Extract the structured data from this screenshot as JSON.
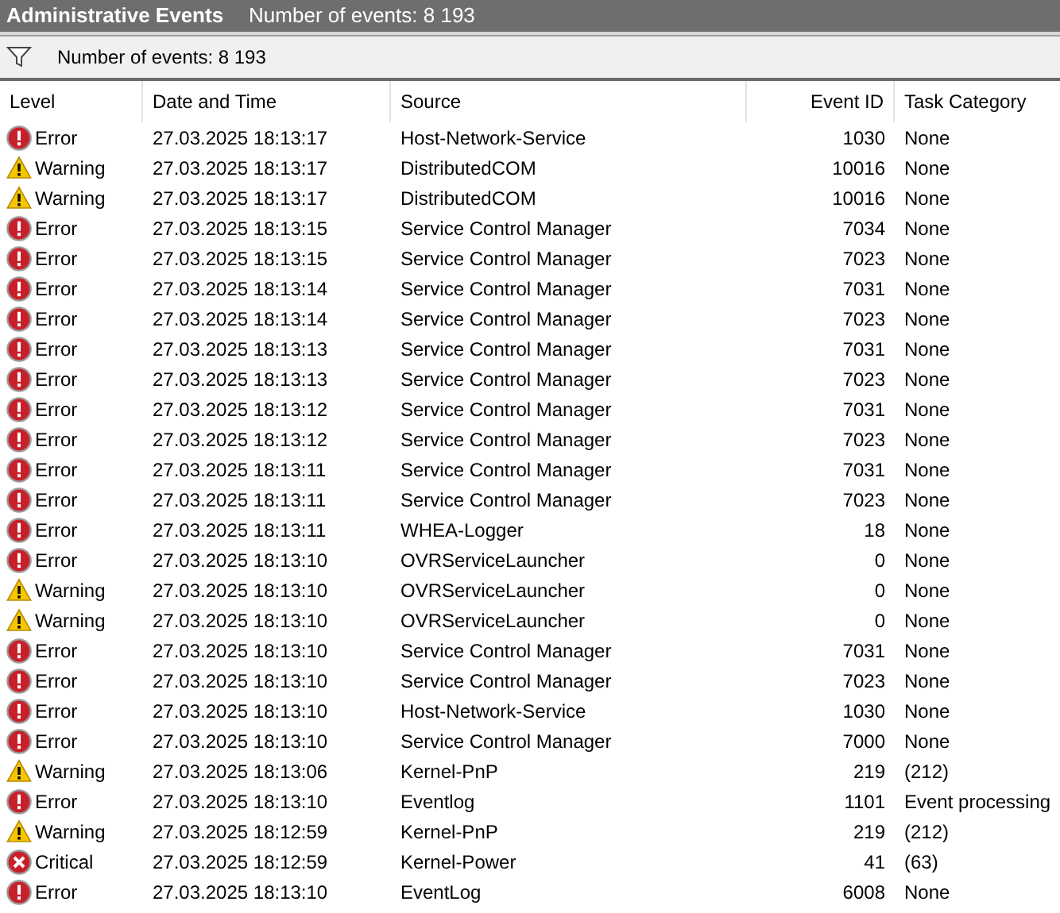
{
  "title_bar": {
    "title": "Administrative Events",
    "count": "Number of events: 8 193"
  },
  "toolbar": {
    "count": "Number of events: 8 193"
  },
  "table": {
    "columns": [
      "Level",
      "Date and Time",
      "Source",
      "Event ID",
      "Task Category"
    ],
    "rows": [
      {
        "kind": "error",
        "level": "Error",
        "date": "27.03.2025 18:13:17",
        "source": "Host-Network-Service",
        "event_id": "1030",
        "category": "None"
      },
      {
        "kind": "warning",
        "level": "Warning",
        "date": "27.03.2025 18:13:17",
        "source": "DistributedCOM",
        "event_id": "10016",
        "category": "None"
      },
      {
        "kind": "warning",
        "level": "Warning",
        "date": "27.03.2025 18:13:17",
        "source": "DistributedCOM",
        "event_id": "10016",
        "category": "None"
      },
      {
        "kind": "error",
        "level": "Error",
        "date": "27.03.2025 18:13:15",
        "source": "Service Control Manager",
        "event_id": "7034",
        "category": "None"
      },
      {
        "kind": "error",
        "level": "Error",
        "date": "27.03.2025 18:13:15",
        "source": "Service Control Manager",
        "event_id": "7023",
        "category": "None"
      },
      {
        "kind": "error",
        "level": "Error",
        "date": "27.03.2025 18:13:14",
        "source": "Service Control Manager",
        "event_id": "7031",
        "category": "None"
      },
      {
        "kind": "error",
        "level": "Error",
        "date": "27.03.2025 18:13:14",
        "source": "Service Control Manager",
        "event_id": "7023",
        "category": "None"
      },
      {
        "kind": "error",
        "level": "Error",
        "date": "27.03.2025 18:13:13",
        "source": "Service Control Manager",
        "event_id": "7031",
        "category": "None"
      },
      {
        "kind": "error",
        "level": "Error",
        "date": "27.03.2025 18:13:13",
        "source": "Service Control Manager",
        "event_id": "7023",
        "category": "None"
      },
      {
        "kind": "error",
        "level": "Error",
        "date": "27.03.2025 18:13:12",
        "source": "Service Control Manager",
        "event_id": "7031",
        "category": "None"
      },
      {
        "kind": "error",
        "level": "Error",
        "date": "27.03.2025 18:13:12",
        "source": "Service Control Manager",
        "event_id": "7023",
        "category": "None"
      },
      {
        "kind": "error",
        "level": "Error",
        "date": "27.03.2025 18:13:11",
        "source": "Service Control Manager",
        "event_id": "7031",
        "category": "None"
      },
      {
        "kind": "error",
        "level": "Error",
        "date": "27.03.2025 18:13:11",
        "source": "Service Control Manager",
        "event_id": "7023",
        "category": "None"
      },
      {
        "kind": "error",
        "level": "Error",
        "date": "27.03.2025 18:13:11",
        "source": "WHEA-Logger",
        "event_id": "18",
        "category": "None"
      },
      {
        "kind": "error",
        "level": "Error",
        "date": "27.03.2025 18:13:10",
        "source": "OVRServiceLauncher",
        "event_id": "0",
        "category": "None"
      },
      {
        "kind": "warning",
        "level": "Warning",
        "date": "27.03.2025 18:13:10",
        "source": "OVRServiceLauncher",
        "event_id": "0",
        "category": "None"
      },
      {
        "kind": "warning",
        "level": "Warning",
        "date": "27.03.2025 18:13:10",
        "source": "OVRServiceLauncher",
        "event_id": "0",
        "category": "None"
      },
      {
        "kind": "error",
        "level": "Error",
        "date": "27.03.2025 18:13:10",
        "source": "Service Control Manager",
        "event_id": "7031",
        "category": "None"
      },
      {
        "kind": "error",
        "level": "Error",
        "date": "27.03.2025 18:13:10",
        "source": "Service Control Manager",
        "event_id": "7023",
        "category": "None"
      },
      {
        "kind": "error",
        "level": "Error",
        "date": "27.03.2025 18:13:10",
        "source": "Host-Network-Service",
        "event_id": "1030",
        "category": "None"
      },
      {
        "kind": "error",
        "level": "Error",
        "date": "27.03.2025 18:13:10",
        "source": "Service Control Manager",
        "event_id": "7000",
        "category": "None"
      },
      {
        "kind": "warning",
        "level": "Warning",
        "date": "27.03.2025 18:13:06",
        "source": "Kernel-PnP",
        "event_id": "219",
        "category": "(212)"
      },
      {
        "kind": "error",
        "level": "Error",
        "date": "27.03.2025 18:13:10",
        "source": "Eventlog",
        "event_id": "1101",
        "category": "Event processing"
      },
      {
        "kind": "warning",
        "level": "Warning",
        "date": "27.03.2025 18:12:59",
        "source": "Kernel-PnP",
        "event_id": "219",
        "category": "(212)"
      },
      {
        "kind": "critical",
        "level": "Critical",
        "date": "27.03.2025 18:12:59",
        "source": "Kernel-Power",
        "event_id": "41",
        "category": "(63)"
      },
      {
        "kind": "error",
        "level": "Error",
        "date": "27.03.2025 18:13:10",
        "source": "EventLog",
        "event_id": "6008",
        "category": "None"
      }
    ]
  }
}
